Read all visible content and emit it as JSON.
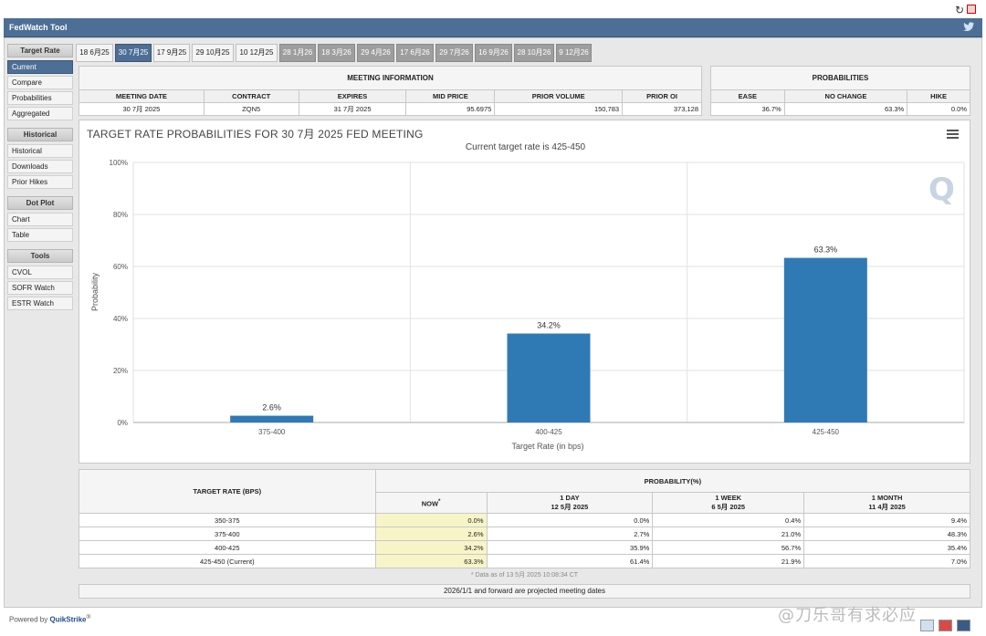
{
  "app": {
    "title": "FedWatch Tool",
    "powered_by_prefix": "Powered by ",
    "powered_by_brand": "QuikStrike",
    "powered_by_reg": "®"
  },
  "sidebar": {
    "sections": [
      {
        "header": "Target Rate",
        "items": [
          "Current",
          "Compare",
          "Probabilities",
          "Aggregated"
        ]
      },
      {
        "header": "Historical",
        "items": [
          "Historical",
          "Downloads",
          "Prior Hikes"
        ]
      },
      {
        "header": "Dot Plot",
        "items": [
          "Chart",
          "Table"
        ]
      },
      {
        "header": "Tools",
        "items": [
          "CVOL",
          "SOFR Watch",
          "ESTR Watch"
        ]
      }
    ]
  },
  "tabs": [
    "18 6月25",
    "30 7月25",
    "17 9月25",
    "29 10月25",
    "10 12月25",
    "28 1月26",
    "18 3月26",
    "29 4月26",
    "17 6月26",
    "29 7月26",
    "16 9月26",
    "28 10月26",
    "9 12月26"
  ],
  "meeting_info": {
    "header": "MEETING INFORMATION",
    "columns": [
      "MEETING DATE",
      "CONTRACT",
      "EXPIRES",
      "MID PRICE",
      "PRIOR VOLUME",
      "PRIOR OI"
    ],
    "values": [
      "30 7月 2025",
      "ZQN5",
      "31 7月 2025",
      "95.6975",
      "150,783",
      "373,128"
    ]
  },
  "probabilities": {
    "header": "PROBABILITIES",
    "columns": [
      "EASE",
      "NO CHANGE",
      "HIKE"
    ],
    "values": [
      "36.7%",
      "63.3%",
      "0.0%"
    ]
  },
  "chart": {
    "title": "TARGET RATE PROBABILITIES FOR 30 7月 2025 FED MEETING",
    "subtitle": "Current target rate is 425-450"
  },
  "chart_data": {
    "type": "bar",
    "categories": [
      "375-400",
      "400-425",
      "425-450"
    ],
    "values": [
      2.6,
      34.2,
      63.3
    ],
    "data_labels": [
      "2.6%",
      "34.2%",
      "63.3%"
    ],
    "xlabel": "Target Rate (in bps)",
    "ylabel": "Probability",
    "ylim": [
      0,
      100
    ],
    "yticks": [
      "0%",
      "20%",
      "40%",
      "60%",
      "80%",
      "100%"
    ],
    "grid": true,
    "bar_color": "#2f7ab5"
  },
  "prob_table": {
    "col_target": "TARGET RATE (BPS)",
    "col_group": "PROBABILITY(%)",
    "col_now": "NOW",
    "col_now_mark": "*",
    "col_1day": "1 DAY",
    "col_1day_date": "12 5月 2025",
    "col_1week": "1 WEEK",
    "col_1week_date": "6 5月 2025",
    "col_1month": "1 MONTH",
    "col_1month_date": "11 4月 2025",
    "rows": [
      {
        "rate": "350-375",
        "now": "0.0%",
        "d1": "0.0%",
        "w1": "0.4%",
        "m1": "9.4%"
      },
      {
        "rate": "375-400",
        "now": "2.6%",
        "d1": "2.7%",
        "w1": "21.0%",
        "m1": "48.3%"
      },
      {
        "rate": "400-425",
        "now": "34.2%",
        "d1": "35.9%",
        "w1": "56.7%",
        "m1": "35.4%"
      },
      {
        "rate": "425-450 (Current)",
        "now": "63.3%",
        "d1": "61.4%",
        "w1": "21.9%",
        "m1": "7.0%"
      }
    ],
    "footnote": "* Data as of 13 5月 2025 10:08:34 CT",
    "projected_note": "2026/1/1 and forward are projected meeting dates"
  },
  "watermark": "@刀乐哥有求必应"
}
